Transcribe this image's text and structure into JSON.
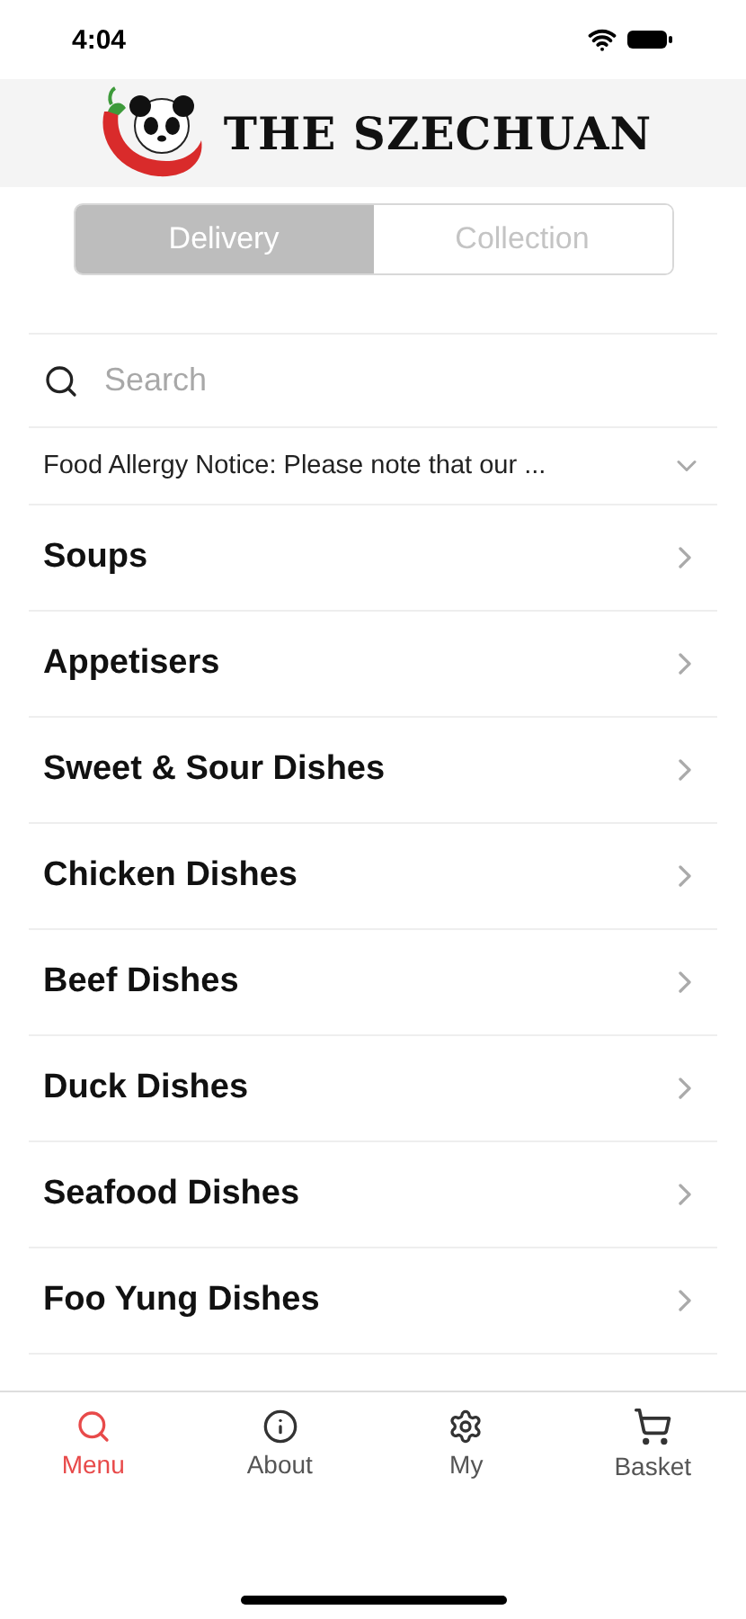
{
  "status_bar": {
    "time": "4:04"
  },
  "header": {
    "title": "THE SZECHUAN"
  },
  "order_modes": [
    {
      "label": "Delivery",
      "selected": true
    },
    {
      "label": "Collection",
      "selected": false
    }
  ],
  "search": {
    "placeholder": "Search"
  },
  "notice": {
    "text": "Food Allergy Notice: Please note that our ...",
    "expanded": false
  },
  "categories": [
    {
      "label": "Soups"
    },
    {
      "label": "Appetisers"
    },
    {
      "label": "Sweet & Sour Dishes"
    },
    {
      "label": "Chicken Dishes"
    },
    {
      "label": "Beef Dishes"
    },
    {
      "label": "Duck Dishes"
    },
    {
      "label": "Seafood Dishes"
    },
    {
      "label": "Foo Yung Dishes"
    }
  ],
  "tab_bar": [
    {
      "label": "Menu",
      "kind": "search",
      "selected": true
    },
    {
      "label": "About",
      "kind": "info",
      "selected": false
    },
    {
      "label": "My",
      "kind": "gear",
      "selected": false
    },
    {
      "label": "Basket",
      "kind": "cart",
      "selected": false
    }
  ]
}
